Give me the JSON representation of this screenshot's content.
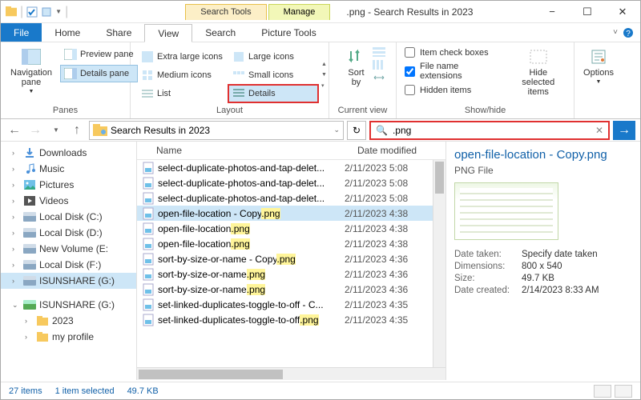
{
  "title": ".png - Search Results in 2023",
  "tool_tabs": {
    "search": "Search Tools",
    "manage": "Manage"
  },
  "menu": {
    "file": "File",
    "home": "Home",
    "share": "Share",
    "view": "View",
    "search": "Search",
    "picture": "Picture Tools"
  },
  "ribbon": {
    "panes": {
      "nav": "Navigation\npane",
      "preview": "Preview pane",
      "details": "Details pane",
      "group": "Panes"
    },
    "layout": {
      "xl": "Extra large icons",
      "l": "Large icons",
      "m": "Medium icons",
      "s": "Small icons",
      "list": "List",
      "details": "Details",
      "group": "Layout"
    },
    "sort": {
      "sortby": "Sort\nby",
      "group": "Current view"
    },
    "showhide": {
      "checkboxes": "Item check boxes",
      "ext": "File name extensions",
      "hidden": "Hidden items",
      "hidesel": "Hide selected\nitems",
      "group": "Show/hide"
    },
    "options": "Options"
  },
  "address": {
    "path": "Search Results in 2023",
    "query": ".png"
  },
  "sidebar": {
    "items": [
      {
        "label": "Downloads",
        "icon": "download",
        "indent": 0
      },
      {
        "label": "Music",
        "icon": "music",
        "indent": 0
      },
      {
        "label": "Pictures",
        "icon": "pictures",
        "indent": 0
      },
      {
        "label": "Videos",
        "icon": "videos",
        "indent": 0
      },
      {
        "label": "Local Disk (C:)",
        "icon": "drive",
        "indent": 0
      },
      {
        "label": "Local Disk (D:)",
        "icon": "drive",
        "indent": 0
      },
      {
        "label": "New Volume (E:",
        "icon": "drive",
        "indent": 0
      },
      {
        "label": "Local Disk (F:)",
        "icon": "drive",
        "indent": 0
      },
      {
        "label": "ISUNSHARE (G:)",
        "icon": "drive",
        "indent": 0,
        "selected": true
      }
    ],
    "group2_label": "ISUNSHARE (G:)",
    "group2_items": [
      {
        "label": "2023"
      },
      {
        "label": "my profile"
      }
    ]
  },
  "columns": {
    "name": "Name",
    "date": "Date modified"
  },
  "files": [
    {
      "name": "select-duplicate-photos-and-tap-delet...",
      "ext": "",
      "date": "2/11/2023 5:08"
    },
    {
      "name": "select-duplicate-photos-and-tap-delet...",
      "ext": "",
      "date": "2/11/2023 5:08"
    },
    {
      "name": "select-duplicate-photos-and-tap-delet...",
      "ext": "",
      "date": "2/11/2023 5:08"
    },
    {
      "name": "open-file-location - Copy",
      "ext": ".png",
      "date": "2/11/2023 4:38",
      "selected": true
    },
    {
      "name": "open-file-location",
      "ext": ".png",
      "date": "2/11/2023 4:38"
    },
    {
      "name": "open-file-location",
      "ext": ".png",
      "date": "2/11/2023 4:38"
    },
    {
      "name": "sort-by-size-or-name - Copy",
      "ext": ".png",
      "date": "2/11/2023 4:36"
    },
    {
      "name": "sort-by-size-or-name",
      "ext": ".png",
      "date": "2/11/2023 4:36"
    },
    {
      "name": "sort-by-size-or-name",
      "ext": ".png",
      "date": "2/11/2023 4:36"
    },
    {
      "name": "set-linked-duplicates-toggle-to-off - C...",
      "ext": "",
      "date": "2/11/2023 4:35"
    },
    {
      "name": "set-linked-duplicates-toggle-to-off",
      "ext": ".png",
      "date": "2/11/2023 4:35"
    }
  ],
  "preview": {
    "title": "open-file-location - Copy.png",
    "type": "PNG File",
    "meta": {
      "date_taken_k": "Date taken:",
      "date_taken_v": "Specify date taken",
      "dim_k": "Dimensions:",
      "dim_v": "800 x 540",
      "size_k": "Size:",
      "size_v": "49.7 KB",
      "created_k": "Date created:",
      "created_v": "2/14/2023 8:33 AM"
    }
  },
  "status": {
    "count": "27 items",
    "sel": "1 item selected",
    "size": "49.7 KB"
  }
}
